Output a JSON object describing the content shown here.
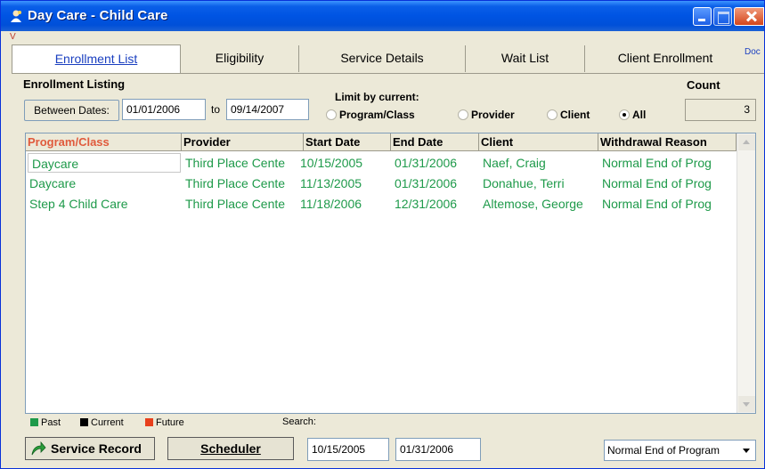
{
  "window": {
    "title": "Day Care - Child Care"
  },
  "corner": {
    "left": "V",
    "right": "Doc"
  },
  "tabs": [
    {
      "label": "Enrollment List",
      "active": true
    },
    {
      "label": "Eligibility",
      "active": false
    },
    {
      "label": "Service Details",
      "active": false
    },
    {
      "label": "Wait List",
      "active": false
    },
    {
      "label": "Client Enrollment",
      "active": false
    }
  ],
  "listing": {
    "heading": "Enrollment Listing",
    "between_label": "Between Dates:",
    "from_date": "01/01/2006",
    "to_label": "to",
    "to_date": "09/14/2007",
    "limit_label": "Limit by current:",
    "options": [
      "Program/Class",
      "Provider",
      "Client",
      "All"
    ],
    "selected_option": "All",
    "count_label": "Count",
    "count_value": "3"
  },
  "table": {
    "columns": [
      "Program/Class",
      "Provider",
      "Start Date",
      "End Date",
      "Client",
      "Withdrawal Reason"
    ],
    "sorted_column": "Program/Class",
    "rows": [
      [
        "Daycare",
        "Third Place Cente",
        "10/15/2005",
        "01/31/2006",
        "Naef, Craig",
        "Normal End of Prog"
      ],
      [
        "Daycare",
        "Third Place Cente",
        "11/13/2005",
        "01/31/2006",
        "Donahue, Terri",
        "Normal End of Prog"
      ],
      [
        "Step 4 Child Care",
        "Third Place Cente",
        "11/18/2006",
        "12/31/2006",
        "Altemose, George",
        "Normal End of Prog"
      ]
    ]
  },
  "legend": [
    {
      "label": "Past",
      "color": "#1e9a4a"
    },
    {
      "label": "Current",
      "color": "#000000"
    },
    {
      "label": "Future",
      "color": "#e8401c"
    }
  ],
  "footer": {
    "search_label": "Search:",
    "service_record_label": "Service Record",
    "scheduler_label": "Scheduler",
    "start_date": "10/15/2005",
    "end_date": "01/31/2006",
    "reason": "Normal End of Program"
  }
}
